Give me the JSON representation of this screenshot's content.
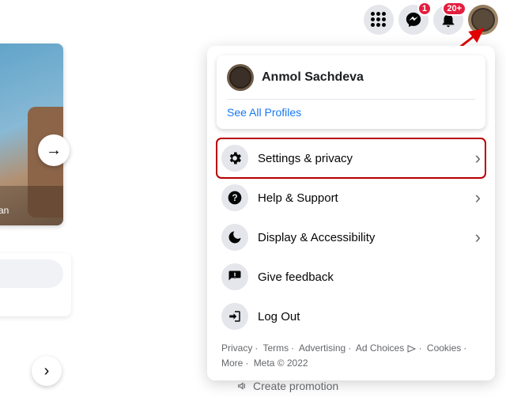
{
  "topnav": {
    "messenger_badge": "1",
    "notifications_badge": "20+"
  },
  "profile": {
    "name": "Anmol Sachdeva",
    "see_all": "See All Profiles"
  },
  "menu": {
    "settings": "Settings & privacy",
    "help": "Help & Support",
    "display": "Display & Accessibility",
    "feedback": "Give feedback",
    "logout": "Log Out"
  },
  "footer": {
    "p1": "Privacy",
    "p2": "Terms",
    "p3": "Advertising",
    "p4": "Ad Choices",
    "p5": "Cookies",
    "p6": "More",
    "p7": "Meta © 2022"
  },
  "left": {
    "caption": "man",
    "bottom_link": "Create promotion"
  }
}
